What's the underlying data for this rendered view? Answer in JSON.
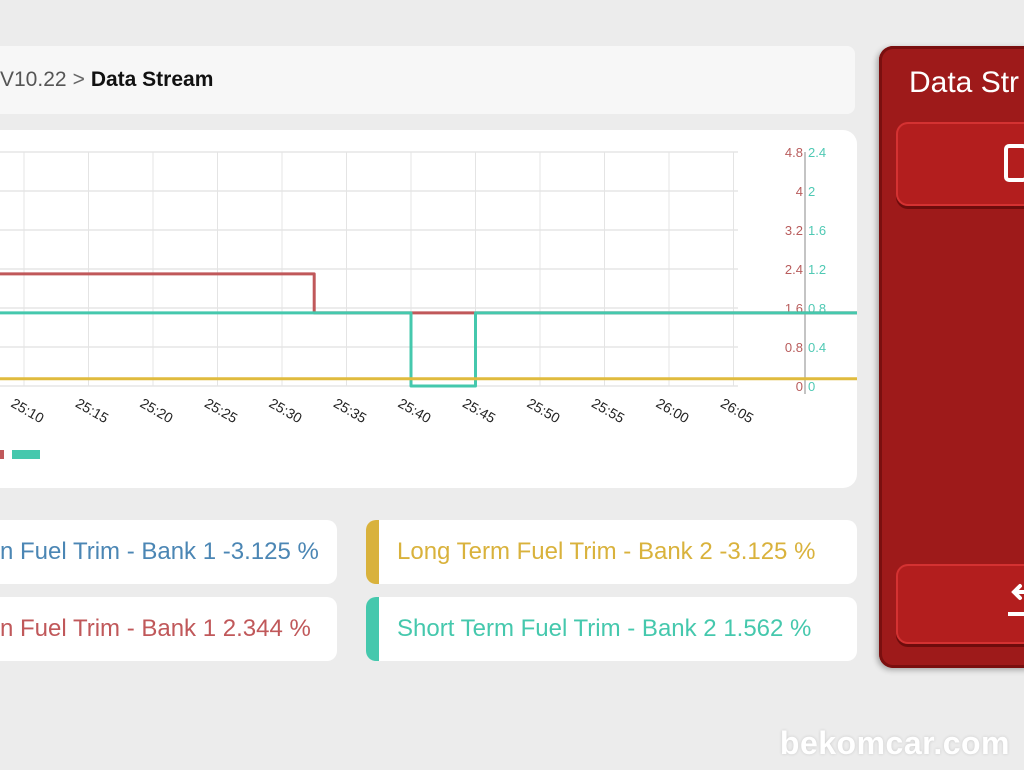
{
  "breadcrumb": {
    "prev": "V10.22",
    "separator": ">",
    "current": "Data Stream"
  },
  "side_panel": {
    "title": "Data Str",
    "top_button_icon": "square-icon",
    "bottom_button_icon": "exit-arrow-icon"
  },
  "chart_data": {
    "type": "line",
    "title": "",
    "x": [
      "25:10",
      "25:15",
      "25:20",
      "25:25",
      "25:30",
      "25:35",
      "25:40",
      "25:45",
      "25:50",
      "25:55",
      "26:00",
      "26:05"
    ],
    "right_axis_inner": {
      "ticks": [
        "4.8",
        "4",
        "3.2",
        "2.4",
        "1.6",
        "0.8",
        "0"
      ],
      "color": "#b85c5c"
    },
    "right_axis_outer": {
      "ticks": [
        "2.4",
        "2",
        "1.6",
        "1.2",
        "0.8",
        "0.4",
        "0"
      ],
      "color": "#4fc9b4"
    },
    "ylim": [
      0,
      4.8
    ],
    "grid": true,
    "series": [
      {
        "color": "#c0585a",
        "steps": [
          [
            25.0,
            2.3
          ],
          [
            25.55,
            2.3
          ],
          [
            25.55,
            1.5
          ],
          [
            25.8,
            1.5
          ],
          [
            25.8,
            1.5
          ],
          [
            25.82,
            1.5
          ],
          [
            25.82,
            1.5
          ],
          [
            26.45,
            1.5
          ],
          [
            26.45,
            2.3
          ],
          [
            27.2,
            2.3
          ]
        ]
      },
      {
        "color": "#45c8ad",
        "steps": [
          [
            25.0,
            1.5
          ],
          [
            25.7,
            1.5
          ],
          [
            25.7,
            0.0
          ],
          [
            25.8,
            0.0
          ],
          [
            25.8,
            1.5
          ],
          [
            26.75,
            1.5
          ],
          [
            26.75,
            3.0
          ],
          [
            27.2,
            3.0
          ]
        ]
      },
      {
        "color": "#e0bb3e",
        "steps": [
          [
            25.0,
            0.15
          ],
          [
            27.2,
            0.15
          ]
        ]
      }
    ]
  },
  "legend": {
    "swatch_colors": [
      "#c0585a",
      "#45c8ad"
    ]
  },
  "values": {
    "ltft_b1": {
      "text": "n Fuel Trim - Bank 1 -3.125 %",
      "color": "#4b86b4"
    },
    "ltft_b2": {
      "text": "Long Term Fuel Trim - Bank 2 -3.125 %",
      "color": "#d9b23c"
    },
    "stft_b1": {
      "text": "n Fuel Trim - Bank 1 2.344 %",
      "color": "#c0585a"
    },
    "stft_b2": {
      "text": "Short Term Fuel Trim - Bank 2 1.562 %",
      "color": "#45c8ad"
    }
  },
  "watermark": "bekomcar.com"
}
